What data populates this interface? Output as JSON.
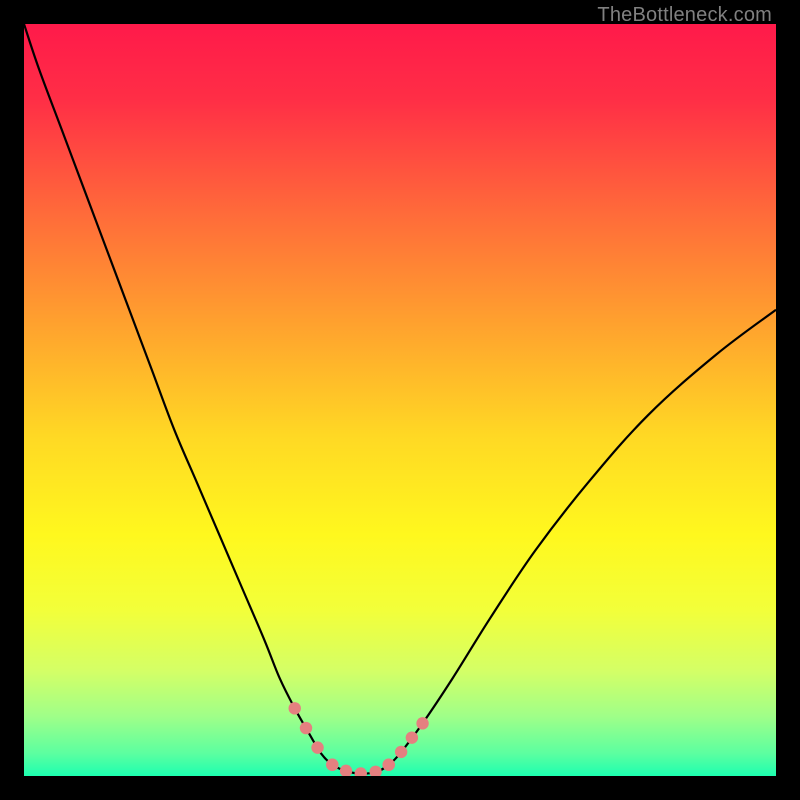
{
  "watermark": "TheBottleneck.com",
  "chart_data": {
    "type": "line",
    "title": "",
    "xlabel": "",
    "ylabel": "",
    "xlim": [
      0,
      100
    ],
    "ylim": [
      0,
      100
    ],
    "x": [
      0,
      2,
      5,
      8,
      11,
      14,
      17,
      20,
      23,
      26,
      29,
      32,
      34,
      36,
      38,
      39.5,
      41,
      43,
      45,
      47,
      48.5,
      50,
      53,
      57,
      62,
      68,
      75,
      83,
      92,
      100
    ],
    "values": [
      100,
      94,
      86,
      78,
      70,
      62,
      54,
      46,
      39,
      32,
      25,
      18,
      13,
      9,
      5.5,
      3,
      1.5,
      0.6,
      0.3,
      0.6,
      1.5,
      3,
      7,
      13,
      21,
      30,
      39,
      48,
      56,
      62
    ],
    "gradient_stops": [
      {
        "offset": 0.0,
        "color": "#ff1a4a"
      },
      {
        "offset": 0.1,
        "color": "#ff2e46"
      },
      {
        "offset": 0.25,
        "color": "#ff6a3a"
      },
      {
        "offset": 0.4,
        "color": "#ffa22e"
      },
      {
        "offset": 0.55,
        "color": "#ffd924"
      },
      {
        "offset": 0.68,
        "color": "#fff81e"
      },
      {
        "offset": 0.78,
        "color": "#f2ff3a"
      },
      {
        "offset": 0.86,
        "color": "#d4ff66"
      },
      {
        "offset": 0.92,
        "color": "#a0ff88"
      },
      {
        "offset": 0.97,
        "color": "#5cffa0"
      },
      {
        "offset": 1.0,
        "color": "#1dffb0"
      }
    ],
    "dot_segments": [
      {
        "start_index": 13,
        "end_index": 16
      },
      {
        "start_index": 16,
        "end_index": 20
      },
      {
        "start_index": 20,
        "end_index": 22
      }
    ],
    "dot_color": "#e58080",
    "curve_color": "#000000",
    "curve_width": 2.2
  }
}
